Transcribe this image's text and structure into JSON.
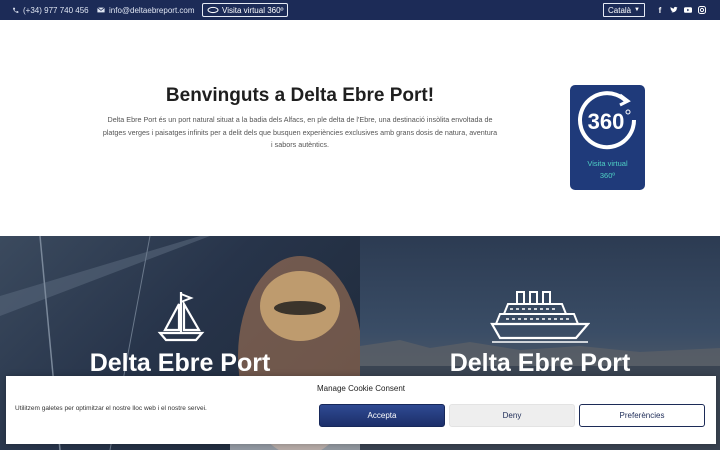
{
  "topbar": {
    "phone": "(+34) 977 740 456",
    "email": "info@deltaebreport.com",
    "tour_button": "Visita virtual 360º",
    "language": "Català",
    "social_icons": [
      "facebook-icon",
      "twitter-icon",
      "youtube-icon",
      "instagram-icon"
    ]
  },
  "intro": {
    "title": "Benvinguts a Delta Ebre Port!",
    "text_line1": "Delta Ebre Port és un port natural situat a la badia dels Alfacs, en ple delta de l'Ebre, una destinació insòlita envoltada de",
    "text_line2": "platges verges i paisatges infinits per a delit dels que busquen experiències exclusives amb grans dosis de natura, aventura",
    "text_line3": "i sabors autèntics."
  },
  "tour_card": {
    "badge": "360",
    "label_line1": "Visita virtual",
    "label_line2": "360º"
  },
  "panels": [
    {
      "title": "Delta Ebre Port",
      "icon": "sailboat-icon"
    },
    {
      "title": "Delta Ebre Port",
      "icon": "ship-icon"
    }
  ],
  "cookie": {
    "title": "Manage Cookie Consent",
    "text": "Utilitzem galetes per optimitzar el nostre lloc web i el nostre servei.",
    "accept": "Accepta",
    "deny": "Deny",
    "preferences": "Preferències"
  },
  "colors": {
    "topbar": "#1c2b57",
    "accent": "#1f3a7a",
    "tour_label": "#4fd0c4"
  }
}
